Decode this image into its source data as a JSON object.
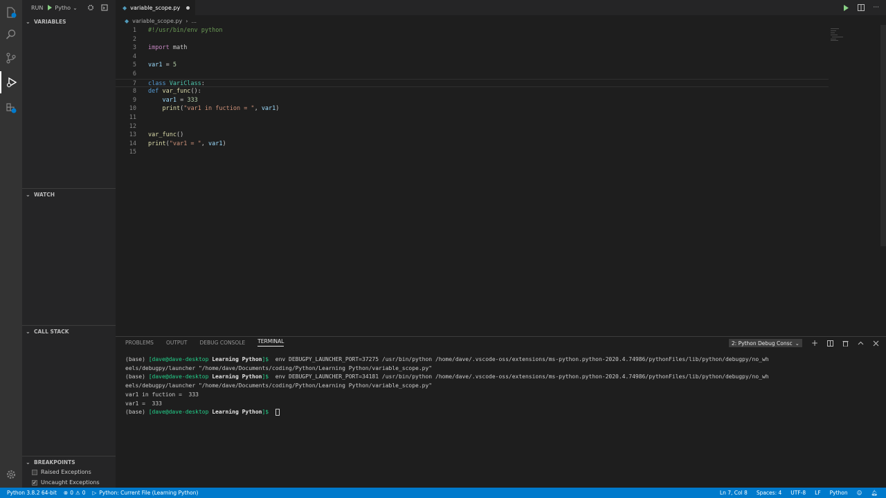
{
  "sidebar": {
    "run_label": "RUN",
    "config_label": "Pytho",
    "sections": {
      "variables": "VARIABLES",
      "watch": "WATCH",
      "call_stack": "CALL STACK",
      "breakpoints": "BREAKPOINTS"
    },
    "breakpoints": [
      {
        "label": "Raised Exceptions",
        "checked": false
      },
      {
        "label": "Uncaught Exceptions",
        "checked": true
      }
    ]
  },
  "tab": {
    "name": "variable_scope.py"
  },
  "breadcrumb": {
    "file": "variable_scope.py",
    "more": "..."
  },
  "editor": {
    "lines": [
      {
        "n": "1",
        "tokens": [
          {
            "t": "#!/usr/bin/env python",
            "c": "cm"
          }
        ]
      },
      {
        "n": "2",
        "tokens": []
      },
      {
        "n": "3",
        "tokens": [
          {
            "t": "import",
            "c": "kw"
          },
          {
            "t": " math",
            "c": ""
          }
        ]
      },
      {
        "n": "4",
        "tokens": []
      },
      {
        "n": "5",
        "tokens": [
          {
            "t": "var1",
            "c": "var"
          },
          {
            "t": " = ",
            "c": ""
          },
          {
            "t": "5",
            "c": "num"
          }
        ]
      },
      {
        "n": "6",
        "tokens": []
      },
      {
        "n": "7",
        "tokens": [
          {
            "t": "class",
            "c": "kwb"
          },
          {
            "t": " ",
            "c": ""
          },
          {
            "t": "VariClass",
            "c": "cls"
          },
          {
            "t": ":",
            "c": ""
          }
        ]
      },
      {
        "n": "8",
        "tokens": [
          {
            "t": "def",
            "c": "kwb"
          },
          {
            "t": " ",
            "c": ""
          },
          {
            "t": "var_func",
            "c": "fn"
          },
          {
            "t": "():",
            "c": ""
          }
        ]
      },
      {
        "n": "9",
        "tokens": [
          {
            "t": "    ",
            "c": ""
          },
          {
            "t": "var1",
            "c": "var"
          },
          {
            "t": " = ",
            "c": ""
          },
          {
            "t": "333",
            "c": "num"
          }
        ]
      },
      {
        "n": "10",
        "tokens": [
          {
            "t": "    ",
            "c": ""
          },
          {
            "t": "print",
            "c": "fn"
          },
          {
            "t": "(",
            "c": ""
          },
          {
            "t": "\"var1 in fuction = \"",
            "c": "str"
          },
          {
            "t": ", ",
            "c": ""
          },
          {
            "t": "var1",
            "c": "var"
          },
          {
            "t": ")",
            "c": ""
          }
        ]
      },
      {
        "n": "11",
        "tokens": []
      },
      {
        "n": "12",
        "tokens": []
      },
      {
        "n": "13",
        "tokens": [
          {
            "t": "var_func",
            "c": "fn"
          },
          {
            "t": "()",
            "c": ""
          }
        ]
      },
      {
        "n": "14",
        "tokens": [
          {
            "t": "print",
            "c": "fn"
          },
          {
            "t": "(",
            "c": ""
          },
          {
            "t": "\"var1 = \"",
            "c": "str"
          },
          {
            "t": ", ",
            "c": ""
          },
          {
            "t": "var1",
            "c": "var"
          },
          {
            "t": ")",
            "c": ""
          }
        ]
      },
      {
        "n": "15",
        "tokens": []
      }
    ]
  },
  "panel": {
    "tabs": [
      "PROBLEMS",
      "OUTPUT",
      "DEBUG CONSOLE",
      "TERMINAL"
    ],
    "selected_tab": "TERMINAL",
    "terminal_select": "2: Python Debug Consc",
    "terminal_lines": [
      {
        "prompt_env": "(base) ",
        "prompt_user": "[dave@dave-desktop ",
        "prompt_dir": "Learning Python",
        "prompt_end": "]$ ",
        "text": " env DEBUGPY_LAUNCHER_PORT=37275 /usr/bin/python /home/dave/.vscode-oss/extensions/ms-python.python-2020.4.74986/pythonFiles/lib/python/debugpy/no_wh"
      },
      {
        "text": "eels/debugpy/launcher \"/home/dave/Documents/coding/Python/Learning Python/variable_scope.py\""
      },
      {
        "prompt_env": "(base) ",
        "prompt_user": "[dave@dave-desktop ",
        "prompt_dir": "Learning Python",
        "prompt_end": "]$ ",
        "text": " env DEBUGPY_LAUNCHER_PORT=34181 /usr/bin/python /home/dave/.vscode-oss/extensions/ms-python.python-2020.4.74986/pythonFiles/lib/python/debugpy/no_wh"
      },
      {
        "text": "eels/debugpy/launcher \"/home/dave/Documents/coding/Python/Learning Python/variable_scope.py\""
      },
      {
        "text": "var1 in fuction =  333"
      },
      {
        "text": "var1 =  333"
      },
      {
        "prompt_env": "(base) ",
        "prompt_user": "[dave@dave-desktop ",
        "prompt_dir": "Learning Python",
        "prompt_end": "]$ ",
        "text": " ",
        "cursor": true
      }
    ]
  },
  "status": {
    "interpreter": "Python 3.8.2 64-bit",
    "errors": "0",
    "warnings": "0",
    "debug_config": "Python: Current File (Learning Python)",
    "position": "Ln 7, Col 8",
    "spaces": "Spaces: 4",
    "encoding": "UTF-8",
    "eol": "LF",
    "language": "Python"
  },
  "colors": {
    "status_bar": "#007acc",
    "activity_bar": "#333333",
    "sidebar": "#252526",
    "editor_bg": "#1e1e1e"
  }
}
